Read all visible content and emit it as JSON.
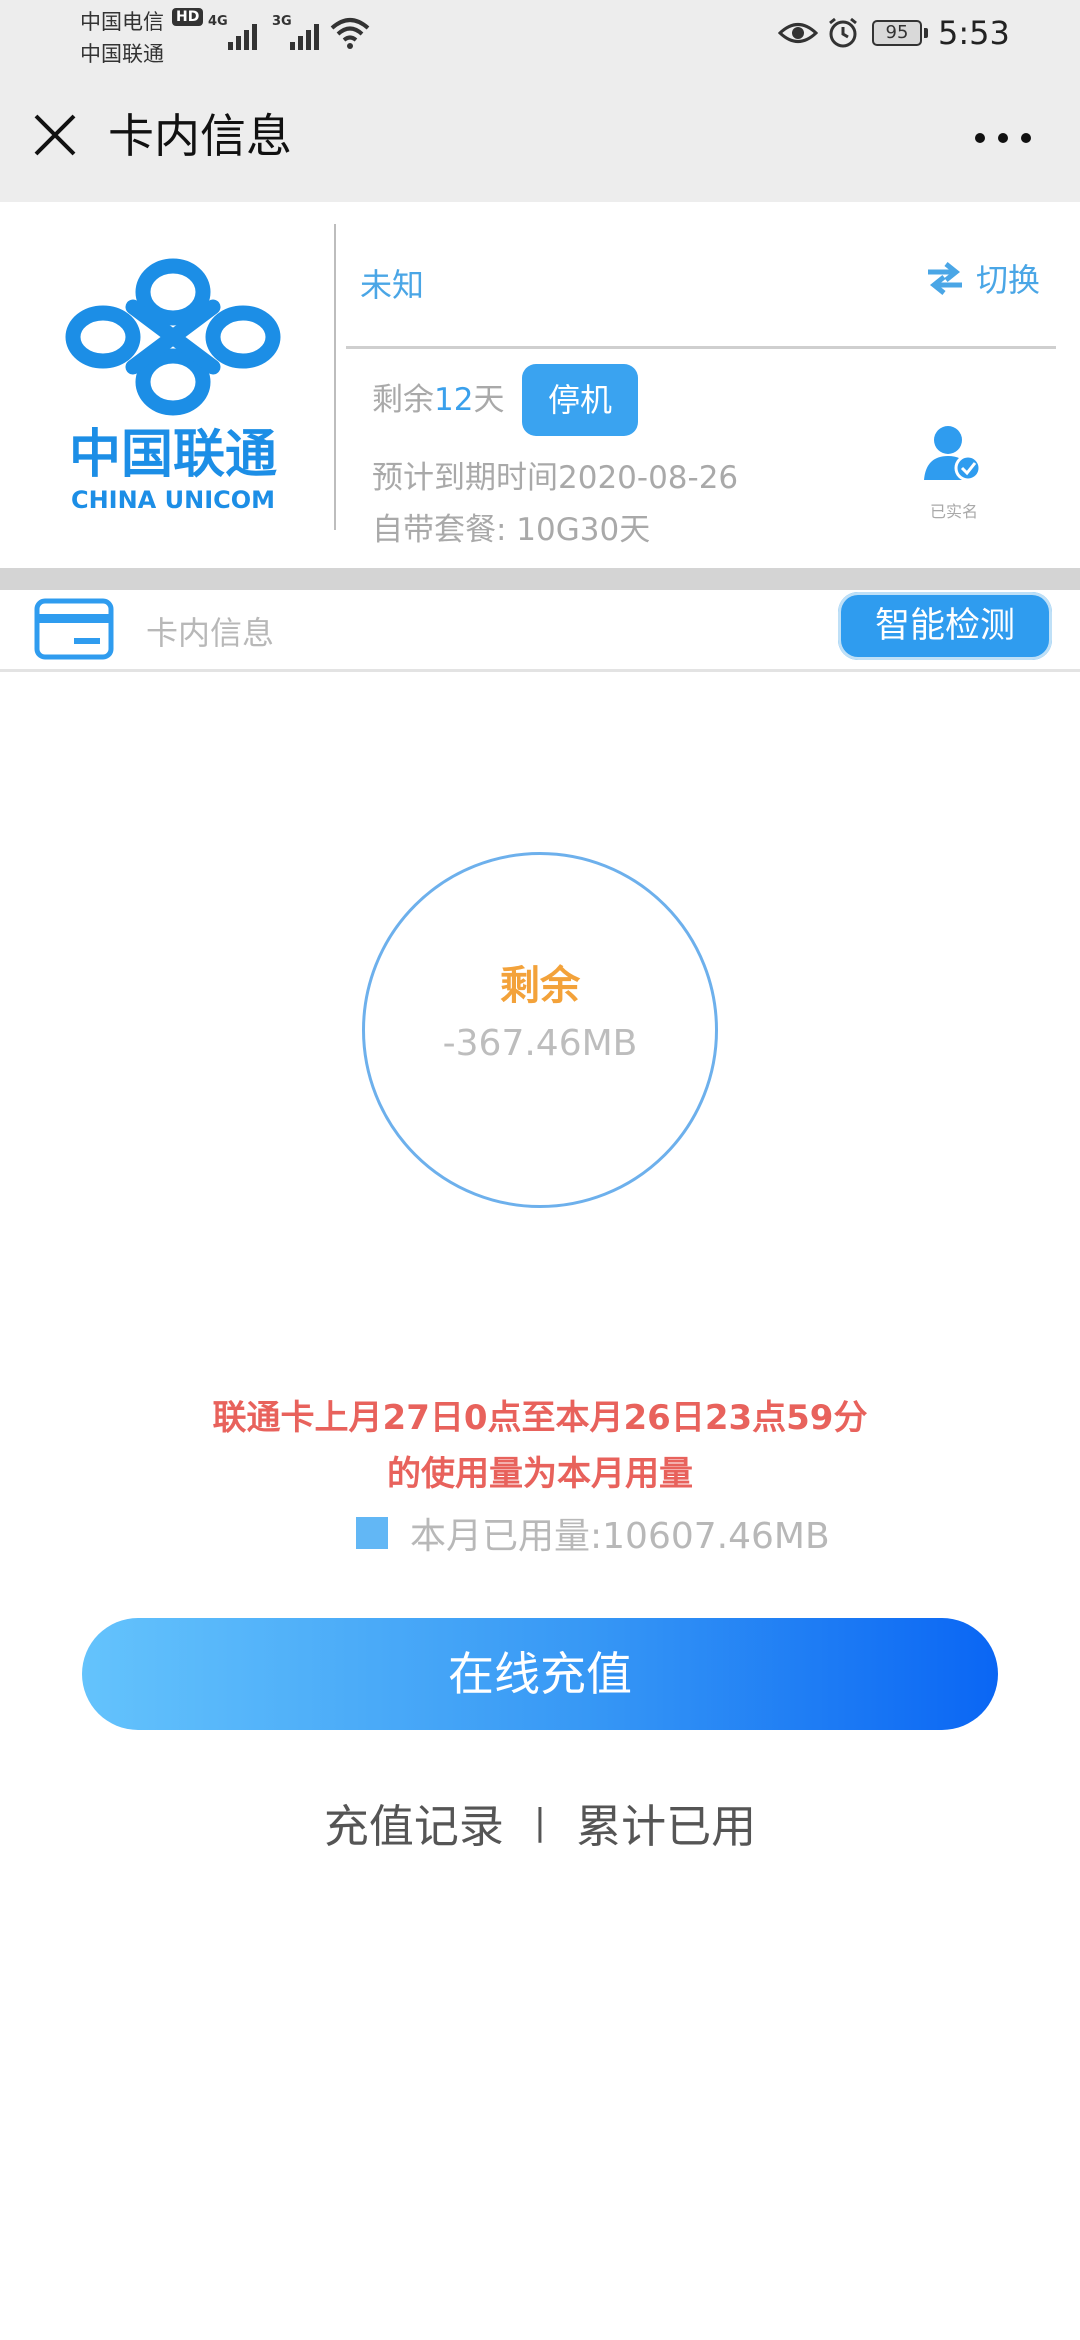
{
  "status_bar": {
    "carrier_1": "中国电信",
    "hd_badge": "HD",
    "net_1": "4G",
    "carrier_2": "中国联通",
    "net_2": "3G",
    "battery": "95",
    "time": "5:53"
  },
  "title_bar": {
    "title": "卡内信息"
  },
  "card": {
    "logo_text_cn": "中国联通",
    "logo_text_en": "CHINA UNICOM",
    "carrier_name": "未知",
    "switch_label": "切换",
    "remain_prefix": "剩余",
    "remain_days": "12",
    "remain_suffix": "天",
    "status_button": "停机",
    "expire_text": "预计到期时间2020-08-26",
    "package_text": "自带套餐:  10G30天",
    "realname_label": "已实名"
  },
  "section": {
    "title": "卡内信息",
    "detect_button": "智能检测"
  },
  "usage": {
    "ring_label": "剩余",
    "ring_value": "-367.46MB",
    "notice_line1": "联通卡上月27日0点至本月26日23点59分",
    "notice_line2": "的使用量为本月用量",
    "legend_text": "本月已用量:10607.46MB"
  },
  "actions": {
    "recharge_button": "在线充值",
    "recharge_record": "充值记录",
    "separator": "|",
    "total_used": "累计已用"
  },
  "colors": {
    "accent_blue": "#3aa3f0",
    "orange": "#f3a23a",
    "notice_red": "#e8625c"
  }
}
